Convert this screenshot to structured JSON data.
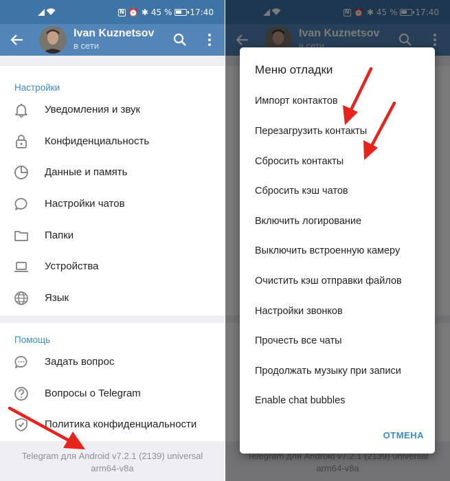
{
  "status_bar": {
    "battery_percent": "45 %",
    "time": "17:40"
  },
  "header": {
    "name": "Ivan Kuznetsov",
    "status": "в сети"
  },
  "settings": {
    "section_title": "Настройки",
    "items": [
      {
        "label": "Уведомления и звук",
        "icon": "bell-icon"
      },
      {
        "label": "Конфиденциальность",
        "icon": "lock-icon"
      },
      {
        "label": "Данные и память",
        "icon": "pie-chart-icon"
      },
      {
        "label": "Настройки чатов",
        "icon": "chat-bubble-icon"
      },
      {
        "label": "Папки",
        "icon": "folder-icon"
      },
      {
        "label": "Устройства",
        "icon": "laptop-icon"
      },
      {
        "label": "Язык",
        "icon": "globe-icon"
      }
    ]
  },
  "help": {
    "section_title": "Помощь",
    "items": [
      {
        "label": "Задать вопрос",
        "icon": "chat-dots-icon"
      },
      {
        "label": "Вопросы о Telegram",
        "icon": "question-icon"
      },
      {
        "label": "Политика конфиденциальности",
        "icon": "shield-icon"
      }
    ]
  },
  "footer": {
    "line1": "Telegram для Android v7.2.1 (2139) universal",
    "line2": "arm64-v8a"
  },
  "debug_menu": {
    "title": "Меню отладки",
    "items": [
      "Импорт контактов",
      "Перезагрузить контакты",
      "Сбросить контакты",
      "Сбросить кэш чатов",
      "Включить логирование",
      "Выключить встроенную камеру",
      "Очистить кэш отправки файлов",
      "Настройки звонков",
      "Прочесть все чаты",
      "Продолжать музыку при записи",
      "Enable chat bubbles"
    ],
    "cancel_label": "ОТМЕНА"
  },
  "colors": {
    "header": "#5385b9",
    "status_bar": "#3f74a7",
    "accent": "#3a8ad0",
    "arrow": "#e8231b"
  }
}
